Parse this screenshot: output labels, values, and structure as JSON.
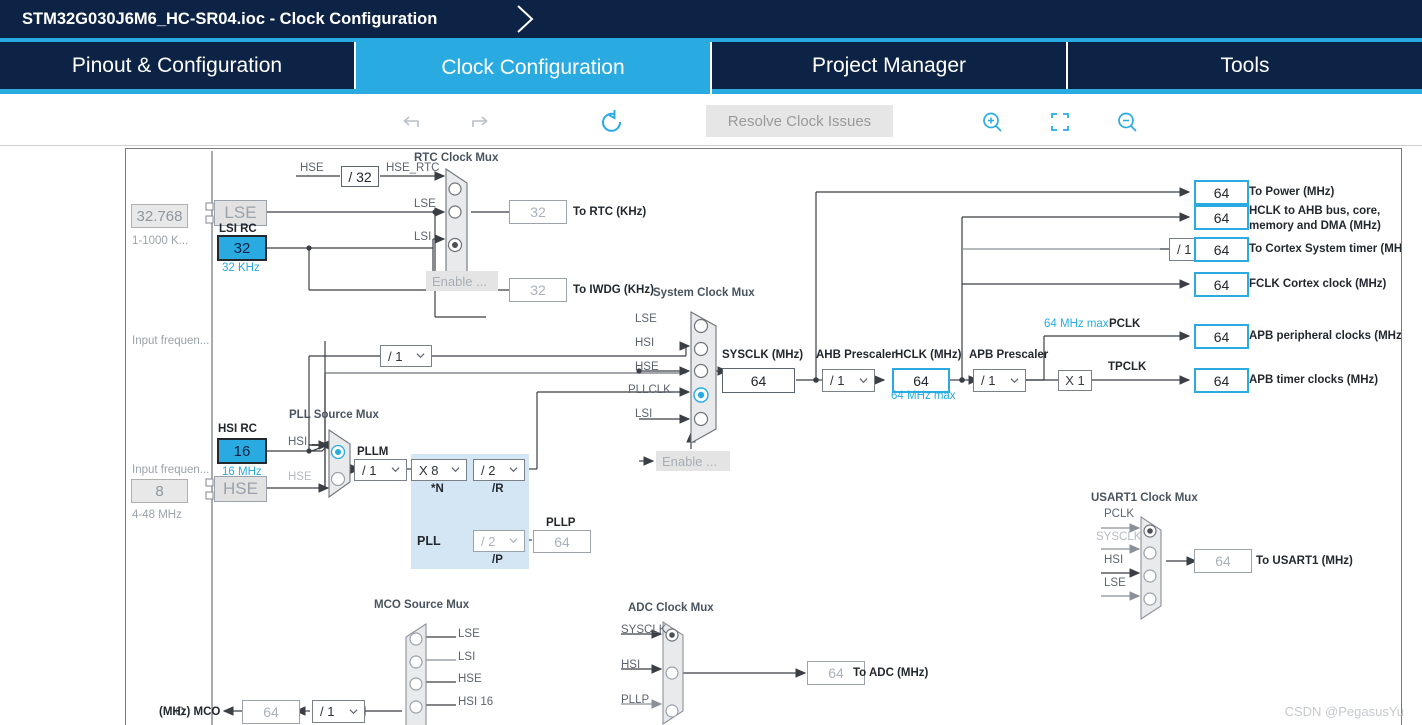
{
  "window": {
    "title": "STM32G030J6M6_HC-SR04.ioc - Clock Configuration"
  },
  "tabs": [
    {
      "label": "Pinout & Configuration",
      "active": false
    },
    {
      "label": "Clock Configuration",
      "active": true
    },
    {
      "label": "Project Manager",
      "active": false
    },
    {
      "label": "Tools",
      "active": false
    }
  ],
  "toolbar": {
    "undo_icon": "undo-icon",
    "redo_icon": "redo-icon",
    "refresh_icon": "refresh-icon",
    "resolve_label": "Resolve Clock Issues",
    "zoom_in_icon": "zoom-in-icon",
    "fit_icon": "fit-to-screen-icon",
    "zoom_out_icon": "zoom-out-icon"
  },
  "diagram": {
    "lse": {
      "input_freq_label": "Input frequen...",
      "input_freq_value": "32.768",
      "range_label": "1-1000 K...",
      "osc_label": "LSE"
    },
    "lsi": {
      "title": "LSI RC",
      "value": "32",
      "unit": "32 KHz"
    },
    "hse": {
      "input_freq_label": "Input frequen...",
      "input_freq_value": "8",
      "range_label": "4-48 MHz",
      "osc_label": "HSE"
    },
    "hsi": {
      "title": "HSI RC",
      "value": "16",
      "unit": "16 MHz",
      "divider": "/ 1"
    },
    "rtc_mux": {
      "title": "RTC Clock Mux",
      "hse_label": "HSE",
      "hse_div": "/ 32",
      "hse_rtc_label": "HSE_RTC",
      "inputs": [
        "HSE_RTC",
        "LSE",
        "LSI"
      ],
      "selected": 2,
      "enable_label": "Enable ...",
      "rtc_out_value": "32",
      "rtc_out_label": "To RTC (KHz)",
      "iwdg_out_value": "32",
      "iwdg_out_label": "To IWDG (KHz)"
    },
    "pll_source_mux": {
      "title": "PLL Source Mux",
      "inputs": [
        "HSI",
        "HSE"
      ],
      "selected": 0
    },
    "pll": {
      "panel_label": "PLL",
      "pllm_label": "PLLM",
      "pllm_value": "/ 1",
      "plln_value": "X 8",
      "plln_label": "*N",
      "pllr_value": "/ 2",
      "pllr_label": "/R",
      "pllp_value": "/ 2",
      "pllp_label": "/P",
      "pllp_out_label": "PLLP",
      "pllp_out_value": "64"
    },
    "system_clock_mux": {
      "title": "System Clock Mux",
      "inputs": [
        "LSE",
        "HSI",
        "HSE",
        "PLLCLK",
        "LSI"
      ],
      "selected": 3,
      "enable_label": "Enable ..."
    },
    "sysclk": {
      "label": "SYSCLK (MHz)",
      "value": "64"
    },
    "ahb_prescaler": {
      "label": "AHB Prescaler",
      "value": "/ 1"
    },
    "hclk": {
      "label": "HCLK (MHz)",
      "value": "64",
      "max_note": "64 MHz max"
    },
    "apb_prescaler": {
      "label": "APB Prescaler",
      "value": "/ 1"
    },
    "pclk": {
      "max_note": "64 MHz max",
      "label": "PCLK"
    },
    "tpclk": {
      "multiplier": "X 1",
      "label": "TPCLK"
    },
    "cortex_divider": "/ 1",
    "outputs": [
      {
        "value": "64",
        "label": "To Power (MHz)"
      },
      {
        "value": "64",
        "label": "HCLK to AHB bus, core, memory and DMA (MHz)"
      },
      {
        "value": "64",
        "label": "To Cortex System timer (MHz)"
      },
      {
        "value": "64",
        "label": "FCLK Cortex clock (MHz)"
      },
      {
        "value": "64",
        "label": "APB peripheral clocks (MHz)"
      },
      {
        "value": "64",
        "label": "APB timer clocks (MHz)"
      }
    ],
    "usart1_mux": {
      "title": "USART1 Clock Mux",
      "inputs": [
        "PCLK",
        "SYSCLK",
        "HSI",
        "LSE"
      ],
      "selected": 0,
      "out_value": "64",
      "out_label": "To USART1 (MHz)"
    },
    "adc_mux": {
      "title": "ADC Clock Mux",
      "inputs": [
        "SYSCLK",
        "HSI",
        "PLLP"
      ],
      "selected": 0,
      "out_value": "64",
      "out_label": "To ADC (MHz)"
    },
    "mco_mux": {
      "title": "MCO Source Mux",
      "inputs": [
        "LSE",
        "LSI",
        "HSE",
        "HSI 16"
      ],
      "selected": -1,
      "out_label": "(MHz) MCO",
      "out_value": "64",
      "divider": "/ 1"
    }
  },
  "watermark": "CSDN @PegasusYu",
  "colors": {
    "brand_dark": "#0d2345",
    "brand_blue": "#29abe2",
    "pll_panel": "#d4e5f4",
    "wire": "#3a3f45"
  }
}
